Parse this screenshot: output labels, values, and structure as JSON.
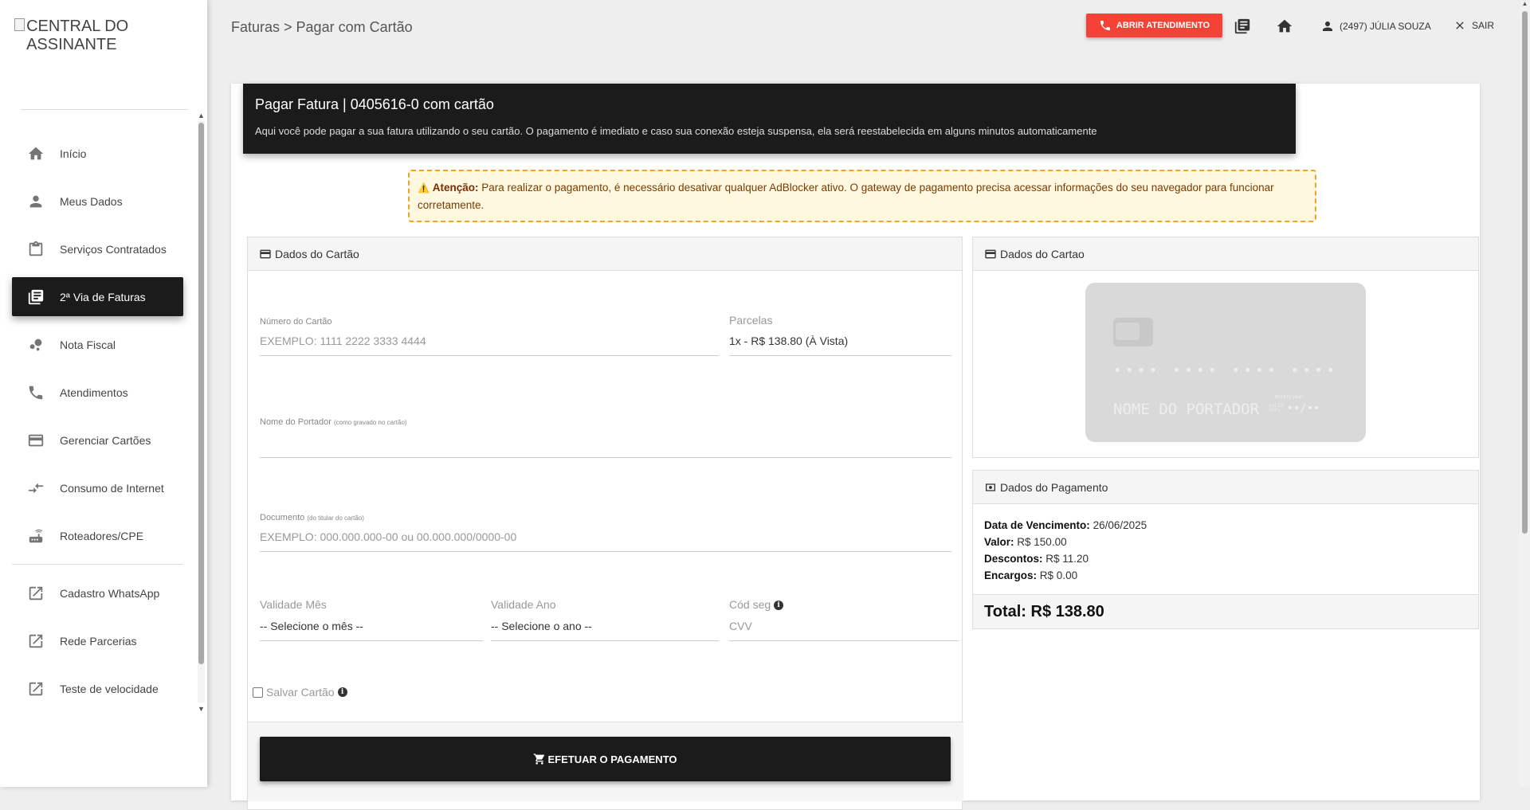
{
  "logo": {
    "alt": "CENTRAL DO ASSINANTE"
  },
  "sidebar": {
    "items": [
      {
        "label": "Início",
        "icon": "home-icon"
      },
      {
        "label": "Meus Dados",
        "icon": "person-icon"
      },
      {
        "label": "Serviços Contratados",
        "icon": "clipboard-icon"
      },
      {
        "label": "2ª Via de Faturas",
        "icon": "library-books-icon",
        "active": true
      },
      {
        "label": "Nota Fiscal",
        "icon": "bubble-chart-icon"
      },
      {
        "label": "Atendimentos",
        "icon": "phone-icon"
      },
      {
        "label": "Gerenciar Cartões",
        "icon": "credit-card-icon"
      },
      {
        "label": "Consumo de Internet",
        "icon": "compare-arrows-icon"
      },
      {
        "label": "Roteadores/CPE",
        "icon": "router-icon"
      },
      {
        "label": "Cadastro WhatsApp",
        "icon": "open-in-new-icon"
      },
      {
        "label": "Rede Parcerias",
        "icon": "open-in-new-icon"
      },
      {
        "label": "Teste de velocidade",
        "icon": "open-in-new-icon"
      }
    ]
  },
  "header": {
    "breadcrumb": "Faturas > Pagar com Cartão",
    "open_ticket_label": "ABRIR ATENDIMENTO",
    "user_label": "(2497) JÚLIA SOUZA",
    "logout_label": "SAIR"
  },
  "hero": {
    "title": "Pagar Fatura | 0405616-0 com cartão",
    "description": "Aqui você pode pagar a sua fatura utilizando o seu cartão. O pagamento é imediato e caso sua conexão esteja suspensa, ela será reestabelecida em alguns minutos automaticamente"
  },
  "alert": {
    "icon": "⚠️",
    "title": "Atenção:",
    "text": "Para realizar o pagamento, é necessário desativar qualquer AdBlocker ativo. O gateway de pagamento precisa acessar informações do seu navegador para funcionar corretamente."
  },
  "form": {
    "header": "Dados do Cartão",
    "card_number_label": "Número do Cartão",
    "card_number_placeholder": "EXEMPLO: 1111 2222 3333 4444",
    "installments_label": "Parcelas",
    "installments_value": "1x - R$ 138.80 (À Vista)",
    "holder_label": "Nome do Portador",
    "holder_hint": "(como gravado no cartão)",
    "document_label": "Documento",
    "document_hint": "(do titular do cartão)",
    "document_placeholder": "EXEMPLO: 000.000.000-00 ou 00.000.000/0000-00",
    "month_label": "Validade Mês",
    "month_value": "-- Selecione o mês --",
    "year_label": "Validade Ano",
    "year_value": "-- Selecione o ano --",
    "cvv_label": "Cód seg",
    "cvv_placeholder": "CVV",
    "save_label": "Salvar Cartão",
    "pay_button": "EFETUAR O PAGAMENTO"
  },
  "card_preview": {
    "header": "Dados do Cartao",
    "number": "•••• •••• •••• ••••",
    "holder": "NOME DO PORTADOR",
    "expiry": "••/••",
    "valid_label": "valid thru",
    "month_year_label": "month/year"
  },
  "payment": {
    "header": "Dados do Pagamento",
    "due_label": "Data de Vencimento:",
    "due_value": "26/06/2025",
    "value_label": "Valor:",
    "value_value": "R$ 150.00",
    "discount_label": "Descontos:",
    "discount_value": "R$ 11.20",
    "charges_label": "Encargos:",
    "charges_value": "R$ 0.00",
    "total": "Total: R$ 138.80"
  }
}
